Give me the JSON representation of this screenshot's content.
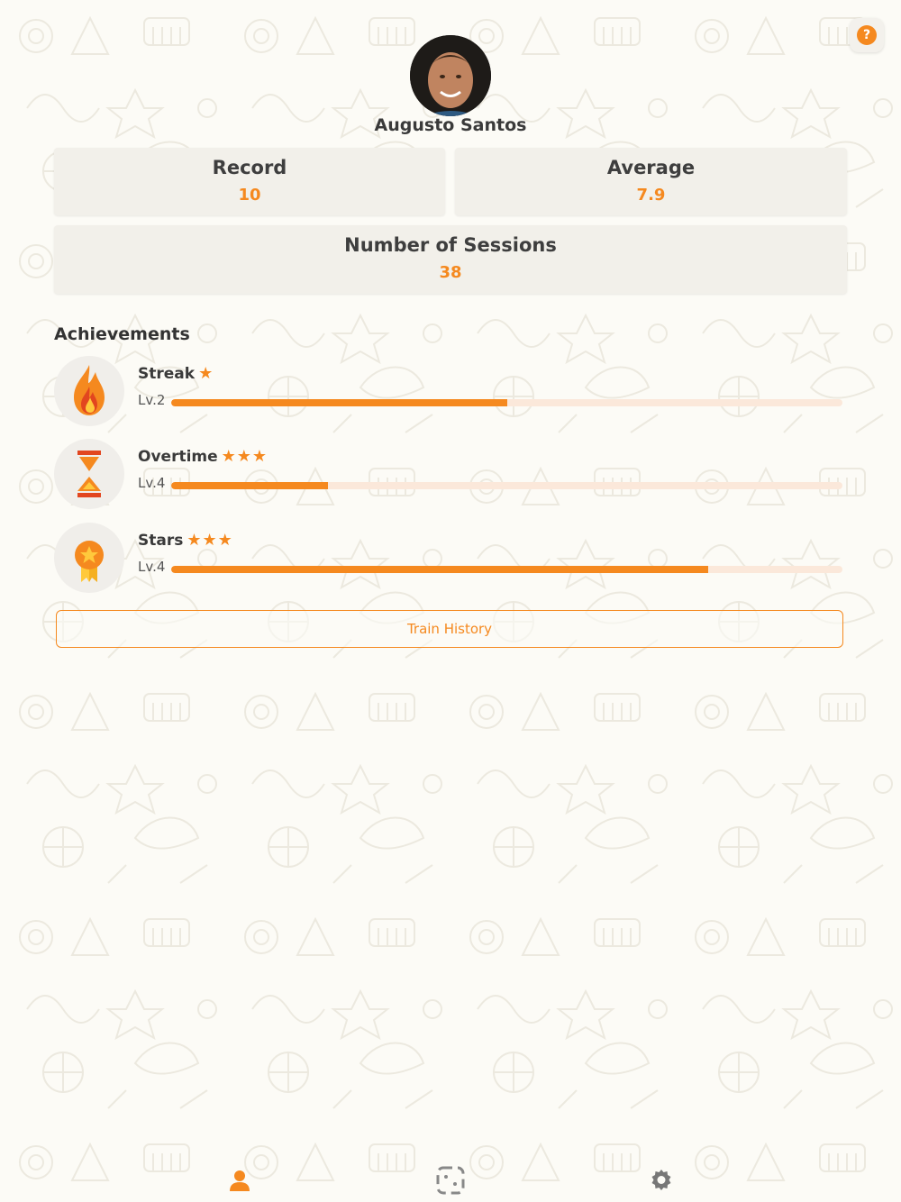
{
  "profile": {
    "name": "Augusto Santos"
  },
  "stats": {
    "record": {
      "label": "Record",
      "value": "10"
    },
    "average": {
      "label": "Average",
      "value": "7.9"
    },
    "sessions": {
      "label": "Number of Sessions",
      "value": "38"
    }
  },
  "achievements": {
    "title": "Achievements",
    "items": [
      {
        "name": "Streak",
        "stars": "★",
        "level": "Lv.2",
        "progress": 0.5,
        "icon": "flame-icon"
      },
      {
        "name": "Overtime",
        "stars": "★★★",
        "level": "Lv.4",
        "progress": 0.233,
        "icon": "hourglass-icon"
      },
      {
        "name": "Stars",
        "stars": "★★★",
        "level": "Lv.4",
        "progress": 0.8,
        "icon": "star-medal-icon"
      }
    ]
  },
  "train_history_label": "Train History",
  "help_label": "?",
  "tabs": [
    {
      "name": "profile",
      "icon": "person-icon",
      "active": true
    },
    {
      "name": "training",
      "icon": "frame-icon",
      "active": false
    },
    {
      "name": "settings",
      "icon": "gear-icon",
      "active": false
    }
  ],
  "colors": {
    "accent": "#f5891f",
    "card": "#f2f0ea",
    "background": "#fcfbf6",
    "track": "#fbe8da"
  }
}
